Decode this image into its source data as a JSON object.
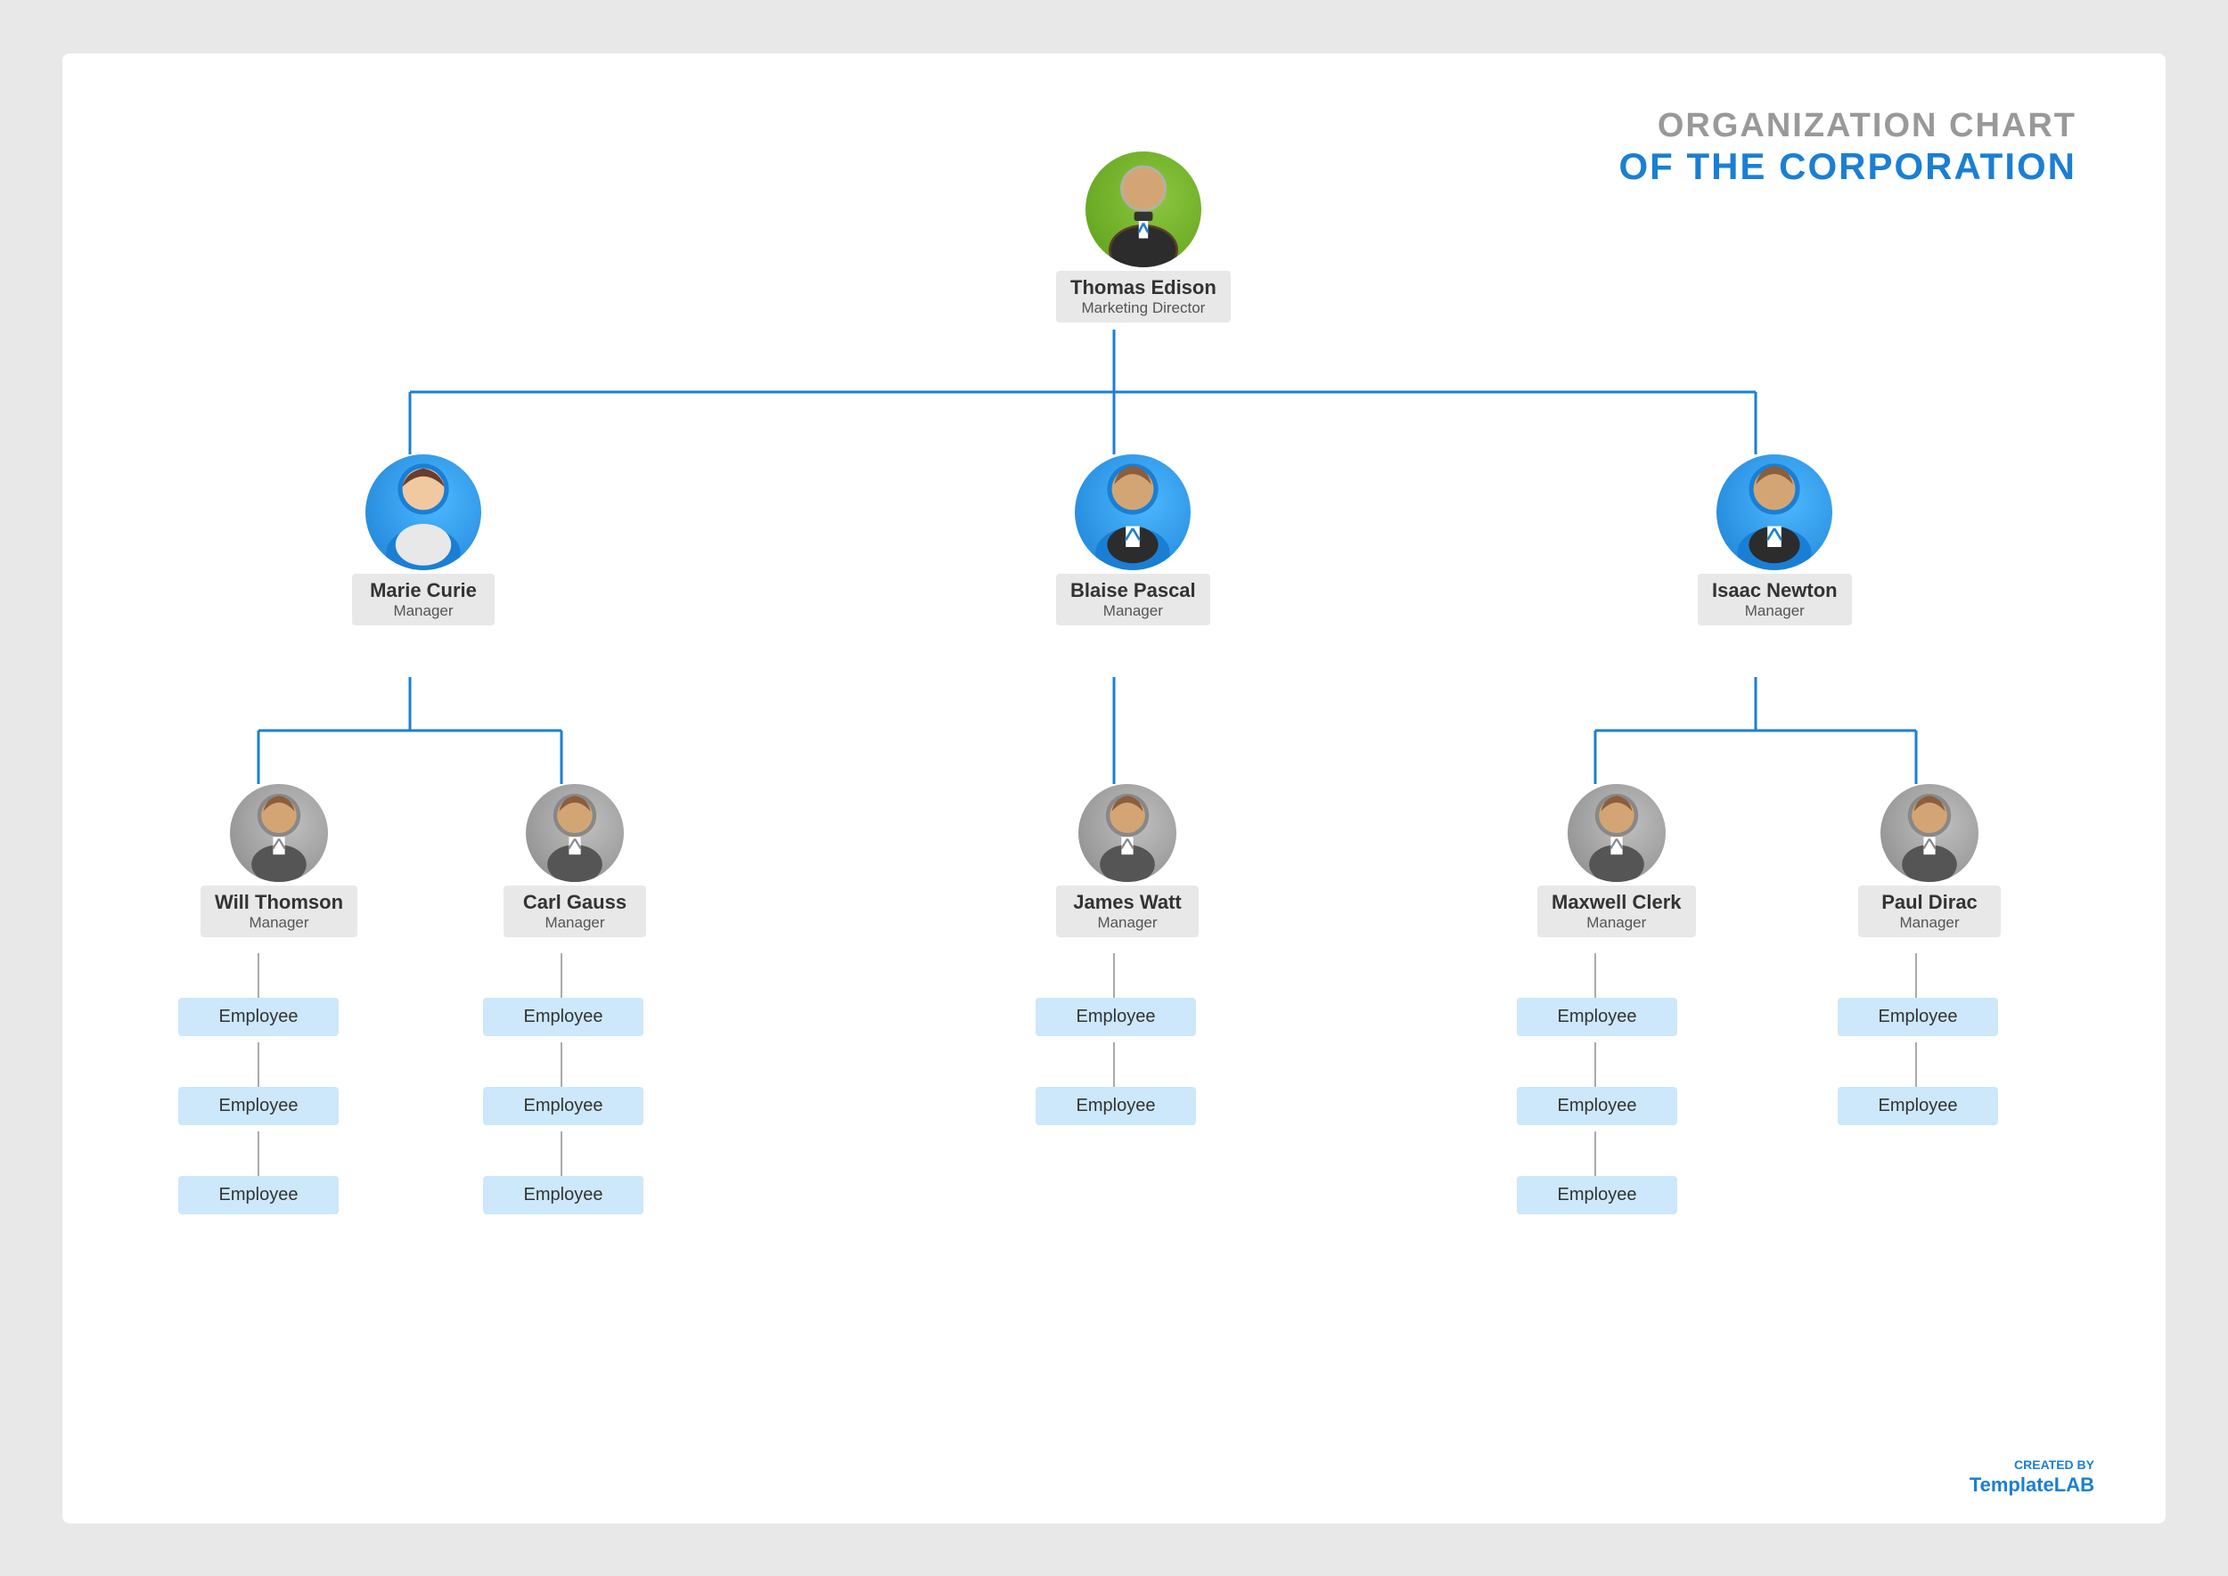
{
  "title": {
    "line1": "ORGANIZATION CHART",
    "line2": "OF THE CORPORATION"
  },
  "branding": {
    "created_by": "CREATED BY",
    "template": "Template",
    "lab": "LAB"
  },
  "ceo": {
    "name": "Thomas Edison",
    "role": "Marketing Director"
  },
  "managers": [
    {
      "name": "Marie Curie",
      "role": "Manager",
      "avatar": "blue-female"
    },
    {
      "name": "Blaise Pascal",
      "role": "Manager",
      "avatar": "blue-male"
    },
    {
      "name": "Isaac Newton",
      "role": "Manager",
      "avatar": "blue-male"
    }
  ],
  "sub_managers": [
    {
      "name": "Will Thomson",
      "role": "Manager",
      "avatar": "gray",
      "parent": 0,
      "employees": [
        "Employee",
        "Employee",
        "Employee"
      ]
    },
    {
      "name": "Carl Gauss",
      "role": "Manager",
      "avatar": "gray",
      "parent": 0,
      "employees": [
        "Employee",
        "Employee",
        "Employee"
      ]
    },
    {
      "name": "James Watt",
      "role": "Manager",
      "avatar": "gray",
      "parent": 1,
      "employees": [
        "Employee",
        "Employee"
      ]
    },
    {
      "name": "Maxwell Clerk",
      "role": "Manager",
      "avatar": "gray",
      "parent": 2,
      "employees": [
        "Employee",
        "Employee",
        "Employee"
      ]
    },
    {
      "name": "Paul Dirac",
      "role": "Manager",
      "avatar": "gray",
      "parent": 2,
      "employees": [
        "Employee",
        "Employee"
      ]
    }
  ]
}
